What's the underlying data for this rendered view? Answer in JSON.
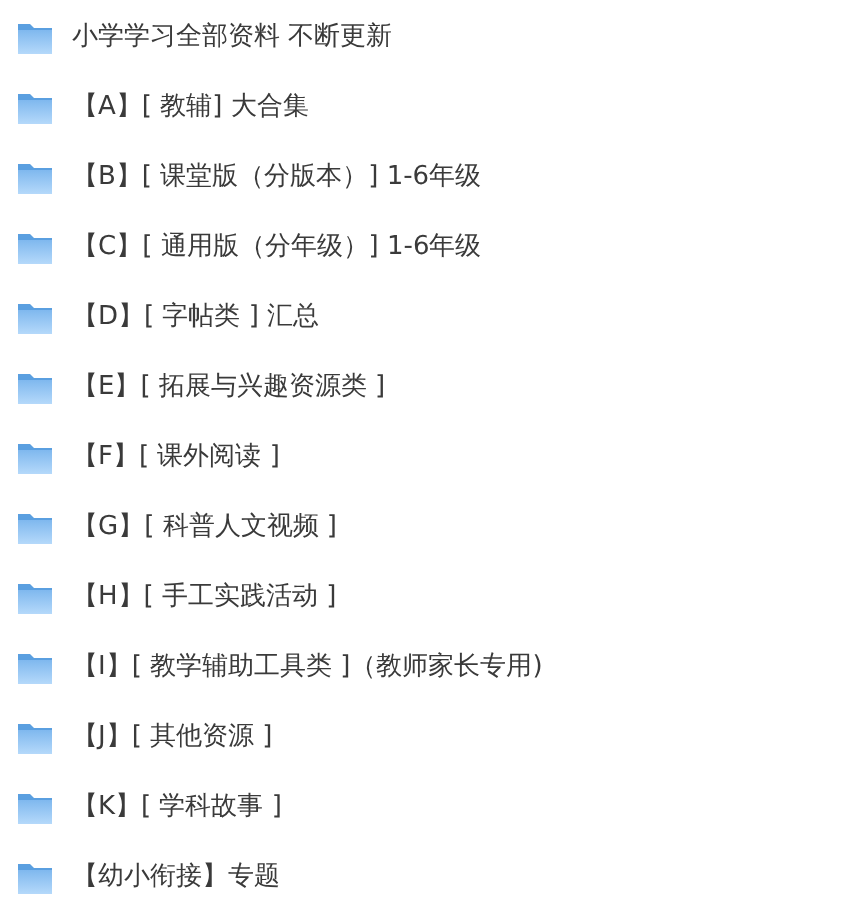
{
  "folders": [
    {
      "name": "小学学习全部资料 不断更新"
    },
    {
      "name": "【A】[ 教辅] 大合集"
    },
    {
      "name": "【B】[ 课堂版（分版本）] 1-6年级"
    },
    {
      "name": "【C】[ 通用版（分年级）] 1-6年级"
    },
    {
      "name": "【D】[ 字帖类 ] 汇总"
    },
    {
      "name": "【E】[ 拓展与兴趣资源类 ]"
    },
    {
      "name": "【F】[ 课外阅读 ]"
    },
    {
      "name": "【G】[ 科普人文视频 ]"
    },
    {
      "name": "【H】[ 手工实践活动 ]"
    },
    {
      "name": "【I】[ 教学辅助工具类 ]（教师家长专用)"
    },
    {
      "name": "【J】[ 其他资源 ]"
    },
    {
      "name": "【K】[ 学科故事 ]"
    },
    {
      "name": "【幼小衔接】专题"
    }
  ]
}
